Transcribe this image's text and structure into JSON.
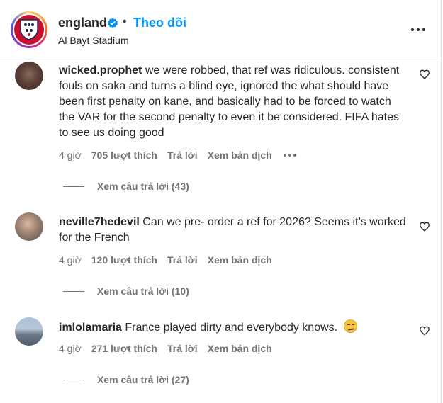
{
  "header": {
    "username": "england",
    "separator": "•",
    "follow_label": "Theo dõi",
    "location": "Al Bayt Stadium",
    "brand_color": "#0095f6"
  },
  "comments": [
    {
      "username": "wicked.prophet",
      "text": "we were robbed, that ref was ridiculous. consistent fouls on saka and turns a blind eye, ignored the what should have been first penalty on kane, and basically had to be forced to watch the VAR for the second penalty to even it be considered. FIFA hates to see us doing good",
      "time": "4 giờ",
      "likes": "705 lượt thích",
      "reply_label": "Trả lời",
      "translate_label": "Xem bản dịch",
      "replies_label": "Xem câu trả lời (43)",
      "has_emoji": false
    },
    {
      "username": "neville7hedevil",
      "text": "Can we pre- order a ref for 2026? Seems it’s worked for the French",
      "time": "4 giờ",
      "likes": "120 lượt thích",
      "reply_label": "Trả lời",
      "translate_label": "Xem bản dịch",
      "replies_label": "Xem câu trả lời (10)",
      "has_emoji": false
    },
    {
      "username": "imlolamaria",
      "text": "France played dirty and everybody knows.",
      "time": "4 giờ",
      "likes": "271 lượt thích",
      "reply_label": "Trả lời",
      "translate_label": "Xem bản dịch",
      "replies_label": "Xem câu trả lời (27)",
      "has_emoji": true
    }
  ]
}
